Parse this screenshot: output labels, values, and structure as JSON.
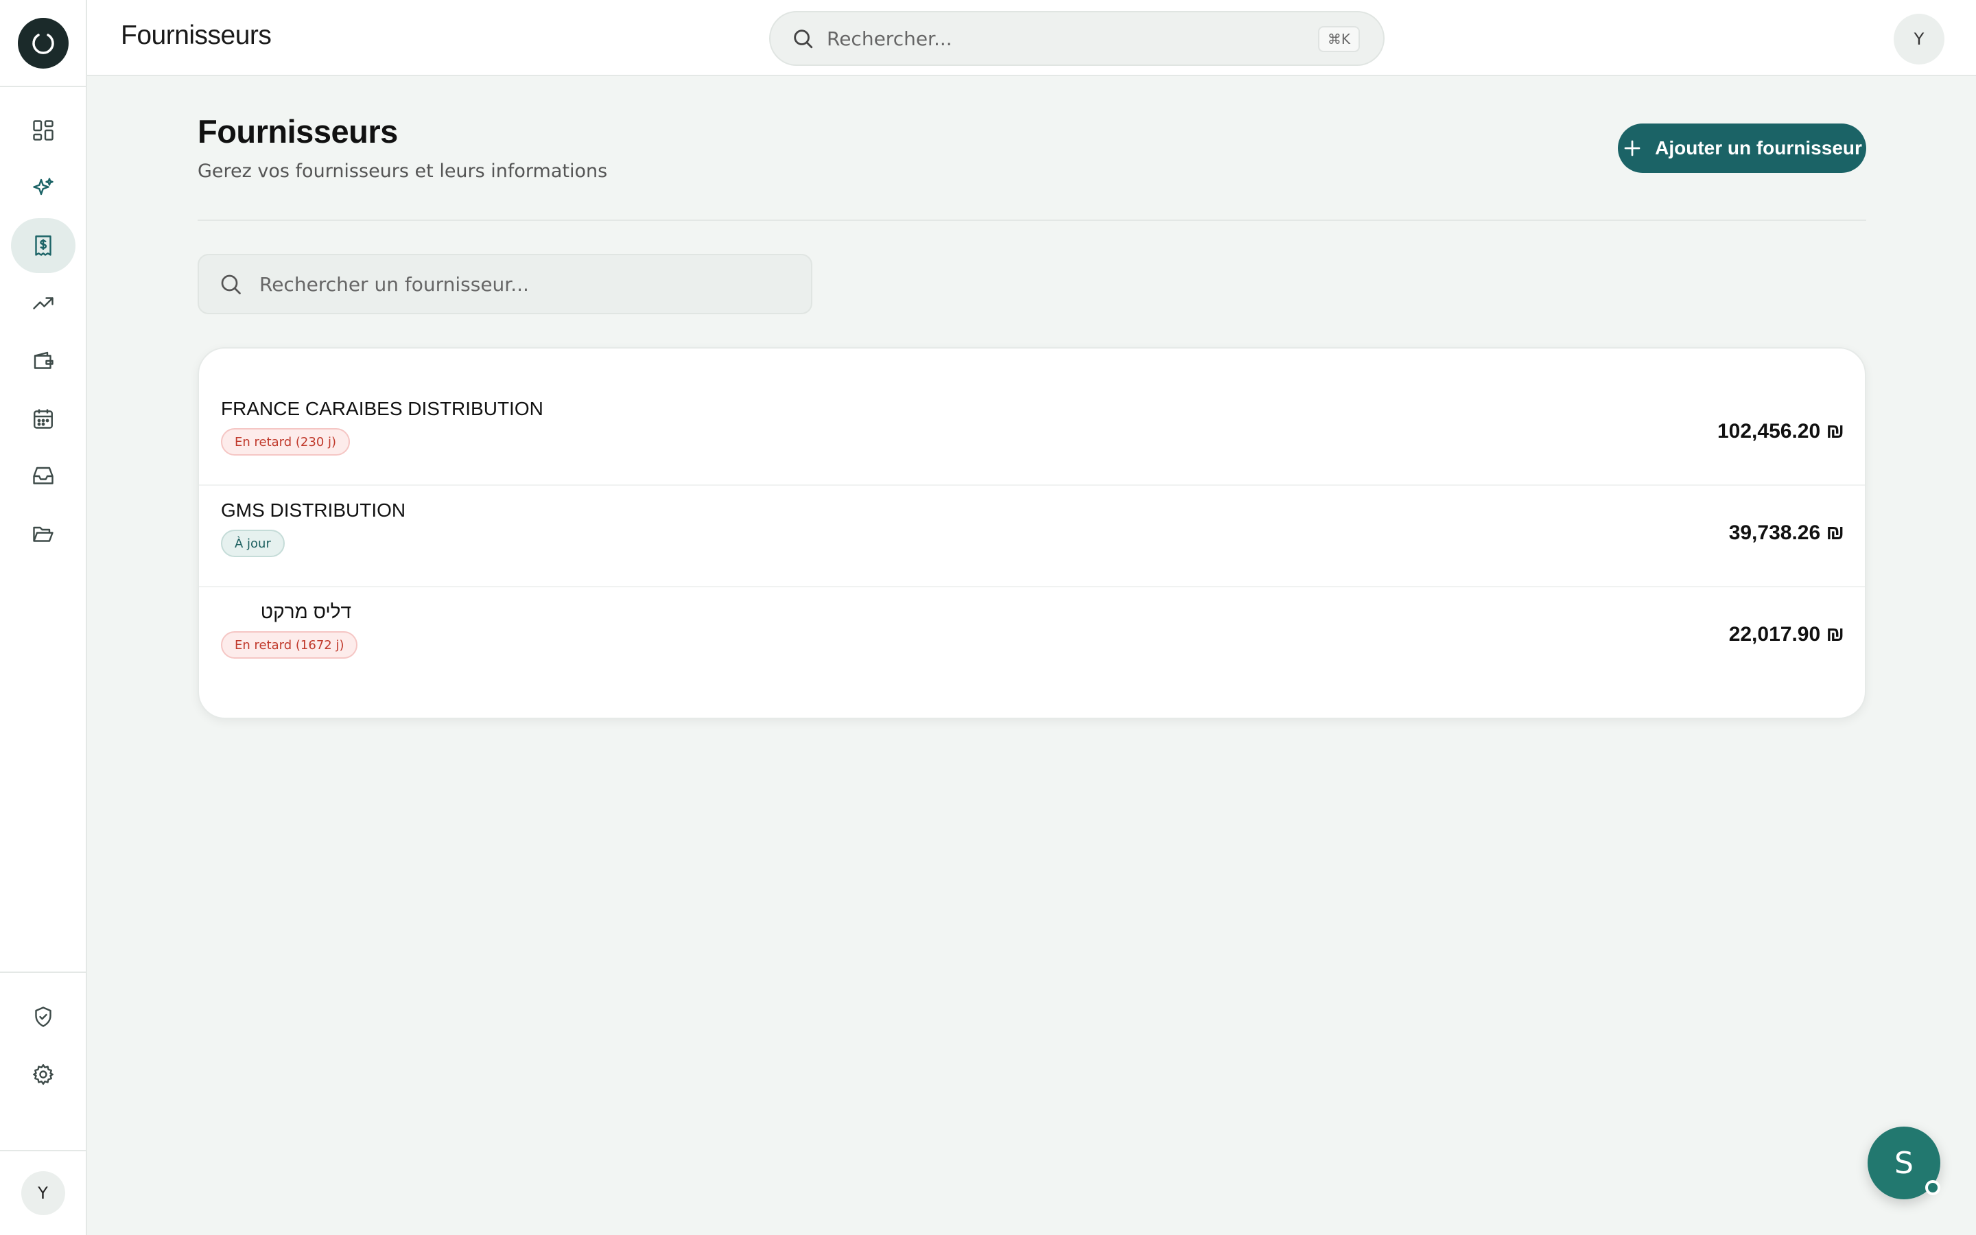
{
  "header": {
    "title": "Fournisseurs",
    "search_placeholder": "Rechercher...",
    "shortcut": "⌘K",
    "avatar_initial": "Y"
  },
  "sidebar": {
    "items": [
      {
        "icon": "dashboard-icon",
        "active": false
      },
      {
        "icon": "sparkles-icon",
        "active": false
      },
      {
        "icon": "receipt-dollar-icon",
        "active": true
      },
      {
        "icon": "trending-up-icon",
        "active": false
      },
      {
        "icon": "wallet-icon",
        "active": false
      },
      {
        "icon": "calendar-icon",
        "active": false
      },
      {
        "icon": "inbox-icon",
        "active": false
      },
      {
        "icon": "folder-open-icon",
        "active": false
      }
    ],
    "bottom_items": [
      {
        "icon": "shield-check-icon"
      },
      {
        "icon": "gear-icon"
      }
    ],
    "user_initial": "Y"
  },
  "main": {
    "title": "Fournisseurs",
    "subtitle": "Gerez vos fournisseurs et leurs informations",
    "add_button_label": "Ajouter un fournisseur",
    "search_placeholder": "Rechercher un fournisseur...",
    "suppliers": [
      {
        "name": "FRANCE CARAIBES DISTRIBUTION",
        "status": "En retard (230 j)",
        "status_type": "late",
        "amount": "102,456.20 ₪"
      },
      {
        "name": "GMS DISTRIBUTION",
        "status": "À jour",
        "status_type": "ok",
        "amount": "39,738.26 ₪"
      },
      {
        "name": "דליס מרקט",
        "status": "En retard (1672 j)",
        "status_type": "late",
        "amount": "22,017.90 ₪"
      }
    ]
  },
  "fab": {
    "initial": "S"
  },
  "colors": {
    "accent": "#1b6366",
    "background": "#f2f5f3",
    "late_text": "#c0392b",
    "ok_text": "#1b5e5e"
  }
}
